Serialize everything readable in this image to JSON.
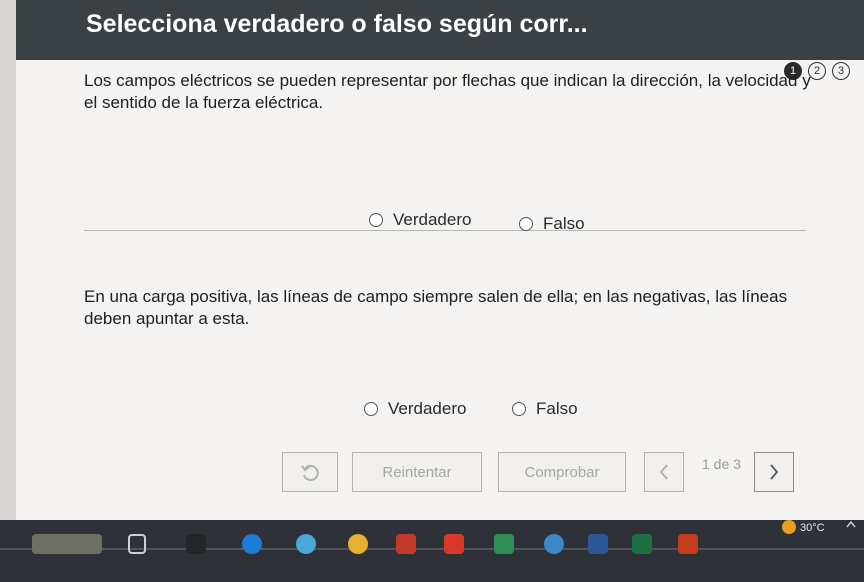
{
  "header": {
    "title": "Selecciona verdadero o falso según corr..."
  },
  "steps": [
    {
      "label": "1",
      "state": "current"
    },
    {
      "label": "2",
      "state": "pending"
    },
    {
      "label": "3",
      "state": "pending"
    }
  ],
  "questions": [
    {
      "text": "Los campos eléctricos se pueden representar por flechas que indican la dirección, la velocidad y el sentido de la fuerza eléctrica.",
      "options": [
        "Verdadero",
        "Falso"
      ]
    },
    {
      "text": "En una carga positiva, las líneas de campo siempre salen de ella; en las negativas, las líneas deben apuntar a esta.",
      "options": [
        "Verdadero",
        "Falso"
      ]
    }
  ],
  "footer": {
    "retry_label": "Reintentar",
    "check_label": "Comprobar",
    "page_count": "1 de 3"
  },
  "taskbar": {
    "temperature": "30°C"
  },
  "colors": {
    "header_bg": "#3b4045",
    "content_bg": "#f4f3f1",
    "disabled_text": "#a7a6a3",
    "taskbar_bg": "#2e3238"
  }
}
